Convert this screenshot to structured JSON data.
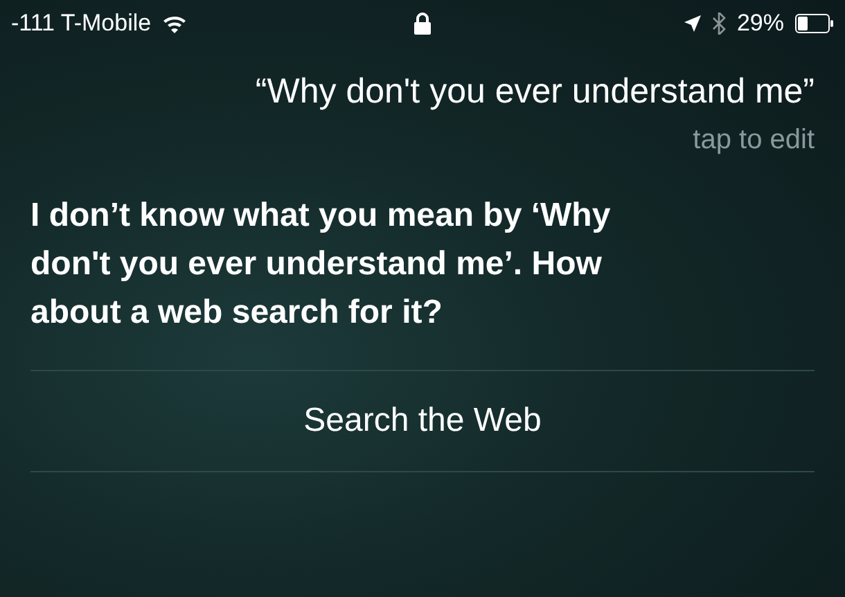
{
  "status_bar": {
    "carrier": "-111 T-Mobile",
    "battery": "29%"
  },
  "query": {
    "text": "“Why don't you ever understand me”",
    "hint": "tap to edit"
  },
  "response": "I don’t know what you mean by ‘Why don't you ever understand me’. How about a web search for it?",
  "actions": [
    "Search the Web"
  ]
}
